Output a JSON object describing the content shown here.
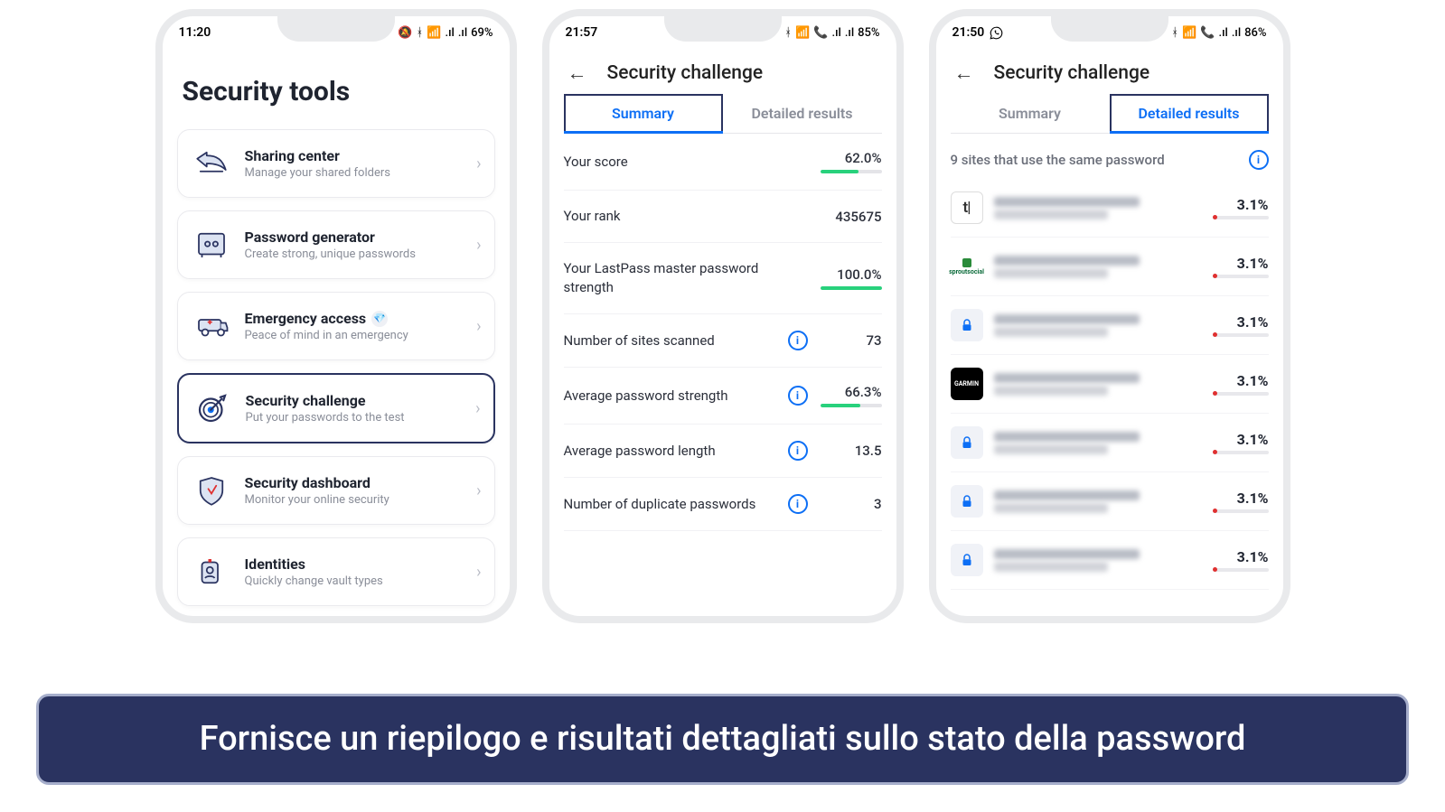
{
  "screens": {
    "tools": {
      "status": {
        "time": "11:20",
        "battery": "69%"
      },
      "title": "Security tools",
      "items": [
        {
          "title": "Sharing center",
          "sub": "Manage your shared folders",
          "badge": false
        },
        {
          "title": "Password generator",
          "sub": "Create strong, unique passwords",
          "badge": false
        },
        {
          "title": "Emergency access",
          "sub": "Peace of mind in an emergency",
          "badge": true
        },
        {
          "title": "Security challenge",
          "sub": "Put your passwords to the test",
          "badge": false
        },
        {
          "title": "Security dashboard",
          "sub": "Monitor your online security",
          "badge": false
        },
        {
          "title": "Identities",
          "sub": "Quickly change vault types",
          "badge": false
        }
      ]
    },
    "summary": {
      "status": {
        "time": "21:57",
        "battery": "85%"
      },
      "title": "Security challenge",
      "tabs": {
        "summary": "Summary",
        "detailed": "Detailed results"
      },
      "stats": {
        "score": {
          "label": "Your score",
          "value": "62.0%",
          "bar": 62
        },
        "rank": {
          "label": "Your rank",
          "value": "435675"
        },
        "master": {
          "label": "Your LastPass master password strength",
          "value": "100.0%",
          "bar": 100
        },
        "sites": {
          "label": "Number of sites scanned",
          "value": "73",
          "info": true
        },
        "avgstr": {
          "label": "Average password strength",
          "value": "66.3%",
          "info": true,
          "bar": 66
        },
        "avglen": {
          "label": "Average password length",
          "value": "13.5",
          "info": true
        },
        "dup": {
          "label": "Number of duplicate passwords",
          "value": "3",
          "info": true
        }
      }
    },
    "detailed": {
      "status": {
        "time": "21:50",
        "battery": "86%"
      },
      "title": "Security challenge",
      "tabs": {
        "summary": "Summary",
        "detailed": "Detailed results"
      },
      "section_head": "9 sites that use the same password",
      "sites": [
        {
          "icon": "tl",
          "pct": "3.1%"
        },
        {
          "icon": "sprout",
          "pct": "3.1%"
        },
        {
          "icon": "lock",
          "pct": "3.1%"
        },
        {
          "icon": "garmin",
          "pct": "3.1%"
        },
        {
          "icon": "lock",
          "pct": "3.1%"
        },
        {
          "icon": "lock",
          "pct": "3.1%"
        },
        {
          "icon": "lock",
          "pct": "3.1%"
        }
      ]
    }
  },
  "caption": "Fornisce un riepilogo e risultati dettagliati sullo stato della password"
}
